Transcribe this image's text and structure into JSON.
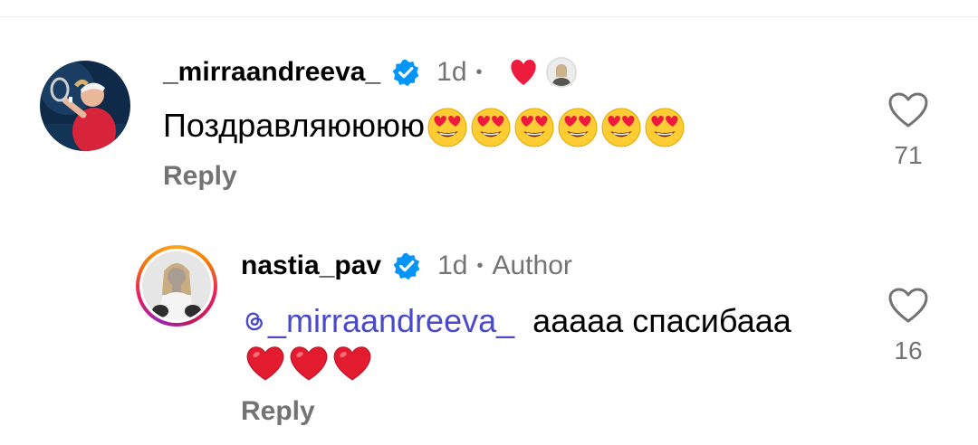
{
  "comments": [
    {
      "username": "_mirraandreeva_",
      "time": "1d",
      "separator": "•",
      "text": "Поздравляюююю",
      "emoji_count": 6,
      "reply_label": "Reply",
      "likes": "71"
    },
    {
      "username": "nastia_pav",
      "time": "1d",
      "separator": "•",
      "author_label": "Author",
      "mention": "_mirraandreeva_",
      "text": "ааааа спасибааа",
      "heart_count": 3,
      "reply_label": "Reply",
      "likes": "16"
    }
  ],
  "icons": {
    "verified": "verified-badge-icon",
    "like": "heart-outline-icon",
    "liked_by_author": "red-heart-icon",
    "mention": "threads-icon"
  },
  "colors": {
    "verified_blue": "#0095f6",
    "meta_gray": "#737373",
    "mention_purple": "#4a4ac8",
    "heart_red": "#ed1c3f"
  }
}
